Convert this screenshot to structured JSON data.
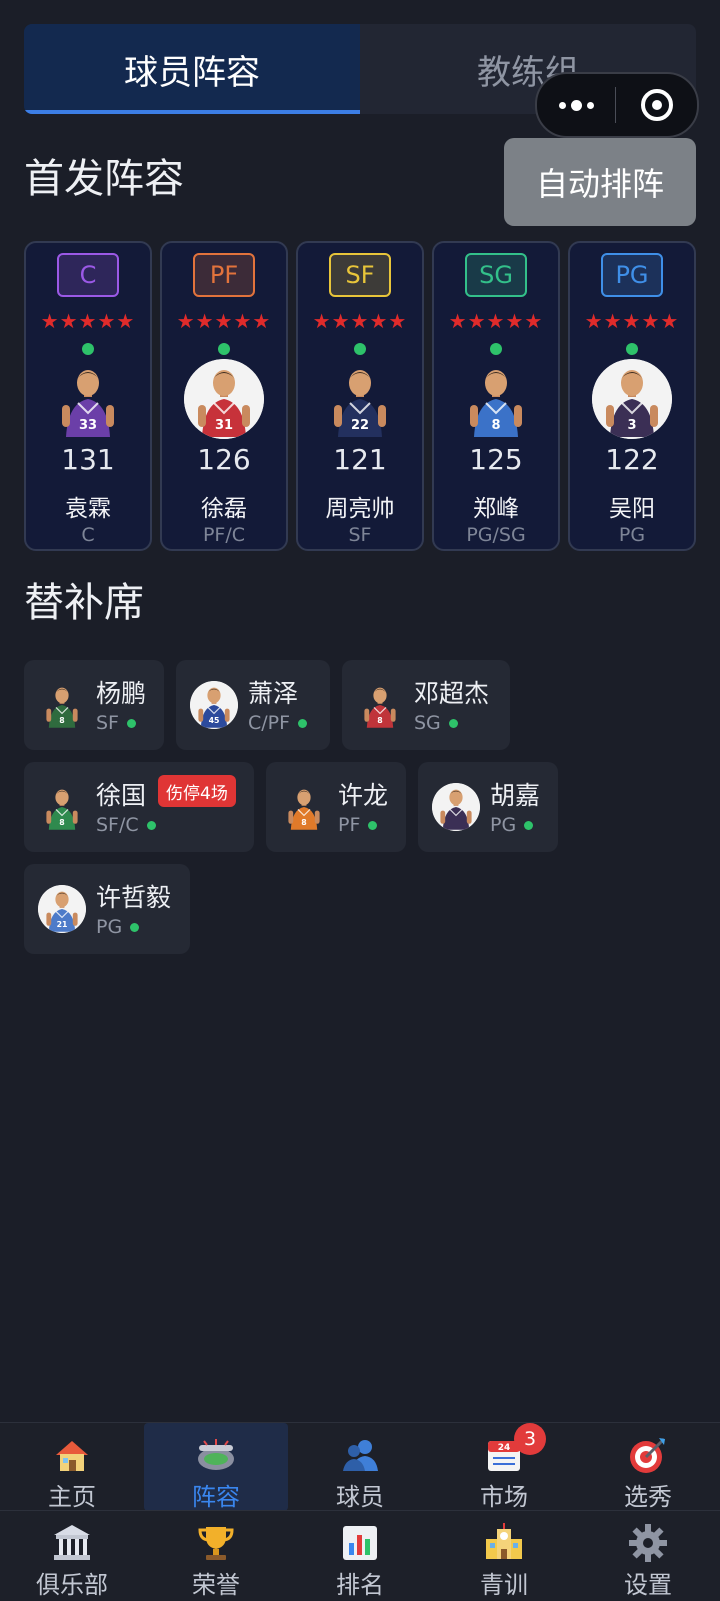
{
  "tabs": {
    "roster": "球员阵容",
    "coaches": "教练组"
  },
  "capsule": {
    "more": "more-icon",
    "close": "close-target-icon"
  },
  "starters_title": "首发阵容",
  "auto_button": "自动排阵",
  "stars": "★★★★★",
  "starters": [
    {
      "badge": "C",
      "badge_color": "#9b59e6",
      "rating": "131",
      "name": "袁霖",
      "pos": "C",
      "jersey": "33",
      "jersey_color": "#6b3fa8",
      "style": "figure"
    },
    {
      "badge": "PF",
      "badge_color": "#e2733c",
      "rating": "126",
      "name": "徐磊",
      "pos": "PF/C",
      "jersey": "31",
      "jersey_color": "#c7323a",
      "style": "circle"
    },
    {
      "badge": "SF",
      "badge_color": "#e8c53a",
      "rating": "121",
      "name": "周亮帅",
      "pos": "SF",
      "jersey": "22",
      "jersey_color": "#23305e",
      "style": "figure"
    },
    {
      "badge": "SG",
      "badge_color": "#33c08a",
      "rating": "125",
      "name": "郑峰",
      "pos": "PG/SG",
      "jersey": "8",
      "jersey_color": "#3b72c8",
      "style": "figure"
    },
    {
      "badge": "PG",
      "badge_color": "#3f8fe8",
      "rating": "122",
      "name": "吴阳",
      "pos": "PG",
      "jersey": "3",
      "jersey_color": "#3b2f55",
      "style": "circle"
    }
  ],
  "bench_title": "替补席",
  "bench": [
    {
      "name": "杨鹏",
      "pos": "SF",
      "jersey": "8",
      "jersey_color": "#2f6b3e",
      "style": "figure"
    },
    {
      "name": "萧泽",
      "pos": "C/PF",
      "jersey": "45",
      "jersey_color": "#2c4a9c",
      "style": "circle"
    },
    {
      "name": "邓超杰",
      "pos": "SG",
      "jersey": "8",
      "jersey_color": "#c0343a",
      "style": "figure"
    },
    {
      "name": "徐国",
      "pos": "SF/C",
      "jersey": "8",
      "jersey_color": "#2f8a4e",
      "style": "figure",
      "injury": "伤停4场"
    },
    {
      "name": "许龙",
      "pos": "PF",
      "jersey": "8",
      "jersey_color": "#e07a2a",
      "style": "figure"
    },
    {
      "name": "胡嘉",
      "pos": "PG",
      "jersey": "",
      "jersey_color": "#3b2f55",
      "style": "circle"
    },
    {
      "name": "许哲毅",
      "pos": "PG",
      "jersey": "21",
      "jersey_color": "#4d7bc9",
      "style": "circle"
    }
  ],
  "nav": {
    "row1": [
      {
        "label": "主页",
        "icon": "house-icon"
      },
      {
        "label": "阵容",
        "icon": "stadium-icon",
        "active": true
      },
      {
        "label": "球员",
        "icon": "people-icon"
      },
      {
        "label": "市场",
        "icon": "calendar-icon",
        "badge": "3"
      },
      {
        "label": "选秀",
        "icon": "target-icon"
      }
    ],
    "row2": [
      {
        "label": "俱乐部",
        "icon": "classical-building-icon"
      },
      {
        "label": "荣誉",
        "icon": "trophy-icon"
      },
      {
        "label": "排名",
        "icon": "bar-chart-icon"
      },
      {
        "label": "青训",
        "icon": "school-icon"
      },
      {
        "label": "设置",
        "icon": "gear-icon"
      }
    ]
  }
}
